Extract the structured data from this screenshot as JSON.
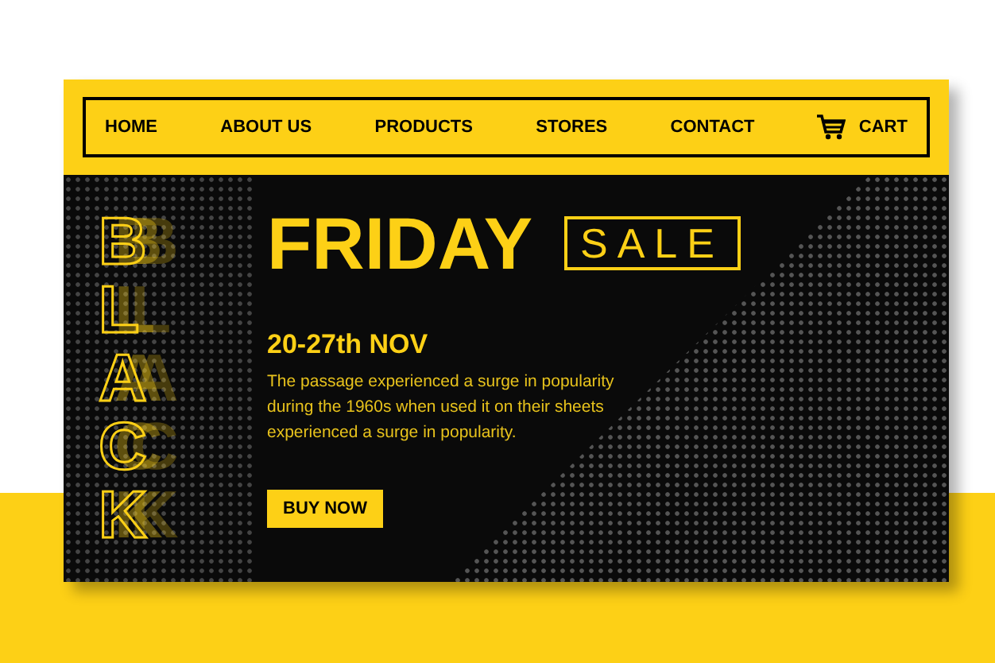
{
  "nav": {
    "items": [
      {
        "label": "HOME",
        "kind": "link"
      },
      {
        "label": "ABOUT US",
        "kind": "link"
      },
      {
        "label": "PRODUCTS",
        "kind": "link"
      },
      {
        "label": "STORES",
        "kind": "link"
      },
      {
        "label": "CONTACT",
        "kind": "link"
      },
      {
        "label": "CART",
        "kind": "cart"
      }
    ]
  },
  "hero": {
    "side_letters": [
      "B",
      "L",
      "A",
      "C",
      "K"
    ],
    "title": "FRIDAY",
    "badge": "SALE",
    "date": "20-27th NOV",
    "description": "The passage experienced a surge in popularity during the 1960s when used it on their sheets experienced a surge in popularity.",
    "button": "BUY NOW"
  }
}
